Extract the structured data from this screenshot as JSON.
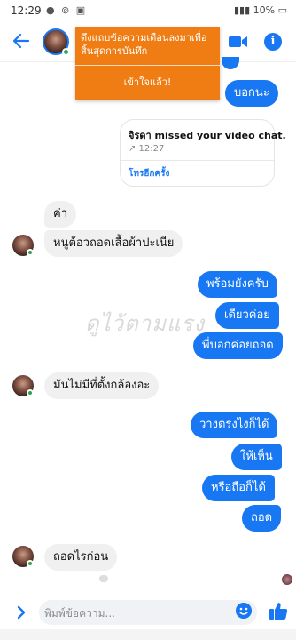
{
  "status_bar": {
    "time": "12:29",
    "left_icons": "● ⊚ ▣",
    "battery": "10%"
  },
  "toast": {
    "message": "ดึงแถบข้อความเตือนลงมาเพื่อสิ้นสุดการบันทึก",
    "button": "เข้าใจแล้ว!"
  },
  "outgoing_top": "บอกนะ",
  "call_card": {
    "title": "จิรดา missed your video chat.",
    "time": "↗ 12:27",
    "action": "โทรอีกครั้ง"
  },
  "messages": {
    "in_1": "ค่า",
    "in_2": "หนูต้อวถอดเสื้อผ้าปะเนีย",
    "out_1": "พร้อมยังครับ",
    "out_2": "เดียวค่อย",
    "out_3": "พี่บอกค่อยถอด",
    "in_3": "มันไม่มีที่ตั้งกล้องอะ",
    "out_4": "วางตรงไงก็ได้",
    "out_5": "ให้เห็น",
    "out_6": "หรือถือก็ได้",
    "out_7": "ถอด",
    "in_4": "ถอดไรก่อน"
  },
  "watermark": "ดูไว้ตามแรง",
  "composer": {
    "placeholder": "พิมพ์ข้อความ..."
  },
  "colors": {
    "accent": "#1877f2",
    "toast": "#ef7d14",
    "incoming_bubble": "#f0f0f0",
    "online": "#31a24c"
  },
  "icons": [
    "back-arrow-icon",
    "video-call-icon",
    "info-icon",
    "chevron-right-icon",
    "emoji-icon",
    "like-icon"
  ]
}
